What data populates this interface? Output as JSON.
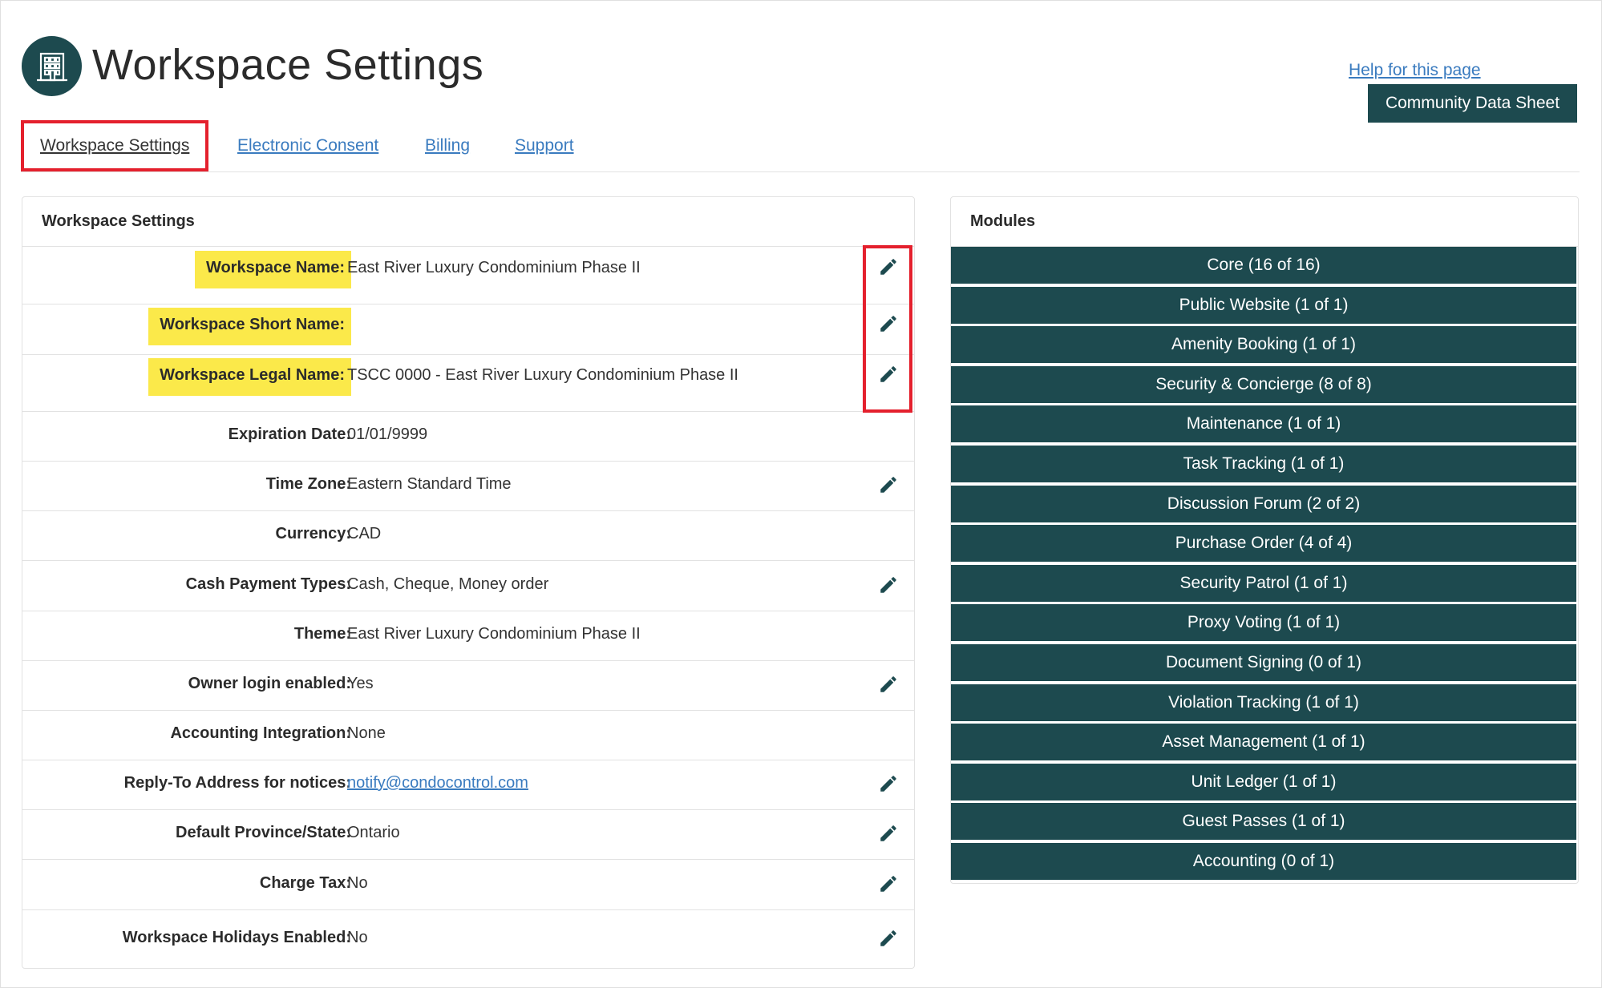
{
  "header": {
    "title": "Workspace Settings",
    "icon": "building-icon",
    "help_link": "Help for this page",
    "community_button": "Community Data Sheet"
  },
  "tabs": [
    {
      "label": "Workspace Settings",
      "active": true
    },
    {
      "label": "Electronic Consent",
      "active": false
    },
    {
      "label": "Billing",
      "active": false
    },
    {
      "label": "Support",
      "active": false
    }
  ],
  "settings": {
    "title": "Workspace Settings",
    "rows": [
      {
        "label": "Workspace Name:",
        "value": "East River Luxury Condominium Phase II",
        "editable": true,
        "highlighted": true
      },
      {
        "label": "Workspace Short Name:",
        "value": "",
        "editable": true,
        "highlighted": true
      },
      {
        "label": "Workspace Legal Name:",
        "value": "TSCC 0000 - East River Luxury Condominium Phase II",
        "editable": true,
        "highlighted": true
      },
      {
        "label": "Expiration Date:",
        "value": "01/01/9999",
        "editable": false
      },
      {
        "label": "Time Zone:",
        "value": "Eastern Standard Time",
        "editable": true
      },
      {
        "label": "Currency:",
        "value": "CAD",
        "editable": false
      },
      {
        "label": "Cash Payment Types:",
        "value": "Cash, Cheque, Money order",
        "editable": true
      },
      {
        "label": "Theme:",
        "value": "East River Luxury Condominium Phase II",
        "editable": false
      },
      {
        "label": "Owner login enabled:",
        "value": "Yes",
        "editable": true
      },
      {
        "label": "Accounting Integration:",
        "value": "None",
        "editable": false
      },
      {
        "label": "Reply-To Address for notices:",
        "value": "notify@condocontrol.com",
        "editable": true,
        "link": true
      },
      {
        "label": "Default Province/State:",
        "value": "Ontario",
        "editable": true
      },
      {
        "label": "Charge Tax:",
        "value": "No",
        "editable": true
      },
      {
        "label": "Workspace Holidays Enabled:",
        "value": "No",
        "editable": true
      }
    ]
  },
  "modules": {
    "title": "Modules",
    "items": [
      "Core (16 of 16)",
      "Public Website (1 of 1)",
      "Amenity Booking (1 of 1)",
      "Security & Concierge (8 of 8)",
      "Maintenance (1 of 1)",
      "Task Tracking (1 of 1)",
      "Discussion Forum (2 of 2)",
      "Purchase Order (4 of 4)",
      "Security Patrol (1 of 1)",
      "Proxy Voting (1 of 1)",
      "Document Signing (0 of 1)",
      "Violation Tracking (1 of 1)",
      "Asset Management (1 of 1)",
      "Unit Ledger (1 of 1)",
      "Guest Passes (1 of 1)",
      "Accounting (0 of 1)"
    ]
  },
  "colors": {
    "brand": "#1d4a4f",
    "link": "#3a7bbf",
    "highlight": "#fbe94a",
    "annotation": "#e4202d"
  }
}
